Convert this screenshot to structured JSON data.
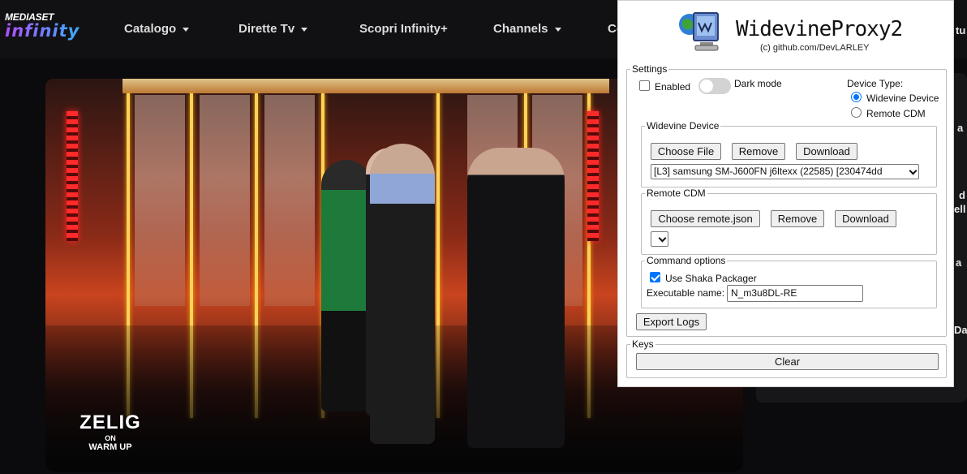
{
  "nav": {
    "brand": "MEDIASET",
    "brand_sub": "infinity",
    "items": [
      {
        "label": "Catalogo",
        "dropdown": true
      },
      {
        "label": "Dirette Tv",
        "dropdown": true
      },
      {
        "label": "Scopri Infinity+",
        "dropdown": false
      },
      {
        "label": "Channels",
        "dropdown": true
      },
      {
        "label": "Co",
        "dropdown": false
      }
    ]
  },
  "video": {
    "overlay_logo": {
      "line1": "ZELIG",
      "line2": "ON",
      "line3": "WARM UP"
    }
  },
  "right_partial": {
    "texts": [
      "tu",
      "a",
      "d",
      "ell",
      "a",
      "Da"
    ]
  },
  "popup": {
    "title": "WidevineProxy2",
    "subtitle": "(c) github.com/DevLARLEY",
    "settings": {
      "legend": "Settings",
      "enabled_label": "Enabled",
      "enabled": false,
      "dark_mode_label": "Dark mode",
      "dark_mode": false,
      "device_type_label": "Device Type:",
      "device_options": [
        {
          "label": "Widevine Device",
          "selected": true
        },
        {
          "label": "Remote CDM",
          "selected": false
        }
      ]
    },
    "widevine_device": {
      "legend": "Widevine Device",
      "choose_label": "Choose File",
      "remove_label": "Remove",
      "download_label": "Download",
      "selected_device": "[L3] samsung SM-J600FN j6ltexx (22585) [230474dd"
    },
    "remote_cdm": {
      "legend": "Remote CDM",
      "choose_label": "Choose remote.json",
      "remove_label": "Remove",
      "download_label": "Download",
      "selected": ""
    },
    "command_options": {
      "legend": "Command options",
      "shaka_label": "Use Shaka Packager",
      "shaka": true,
      "exec_label": "Executable name:",
      "exec_value": "N_m3u8DL-RE"
    },
    "export_logs_label": "Export Logs",
    "keys": {
      "legend": "Keys",
      "clear_label": "Clear"
    }
  }
}
